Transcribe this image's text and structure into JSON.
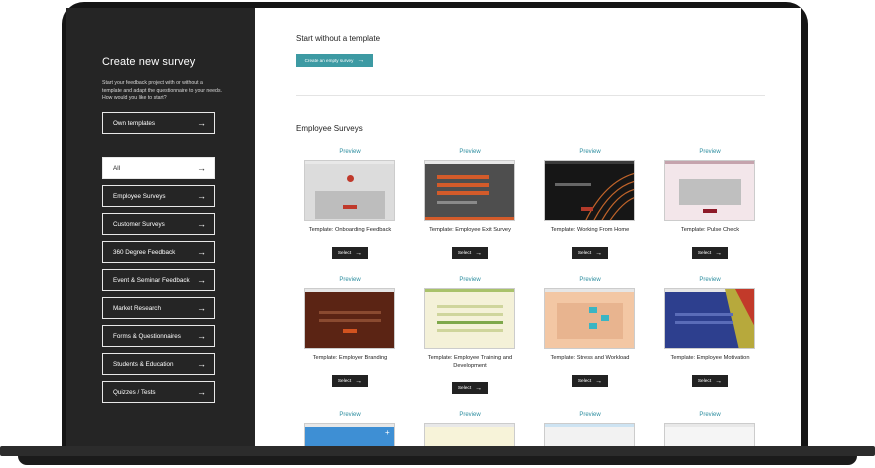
{
  "sidebar": {
    "title": "Create new survey",
    "description": "Start your feedback project with or without a template and adapt the questionnaire to your needs. How would you like to start?",
    "own_templates": "Own templates",
    "categories": [
      {
        "label": "All",
        "active": true
      },
      {
        "label": "Employee Surveys"
      },
      {
        "label": "Customer Surveys"
      },
      {
        "label": "360 Degree Feedback"
      },
      {
        "label": "Event & Seminar Feedback"
      },
      {
        "label": "Market Research"
      },
      {
        "label": "Forms & Questionnaires"
      },
      {
        "label": "Students & Education"
      },
      {
        "label": "Quizzes / Tests"
      }
    ],
    "arrow_icon": "arrow-right-icon"
  },
  "main": {
    "start_heading": "Start without a template",
    "create_empty_label": "Create an empty survey",
    "section_heading": "Employee Surveys",
    "preview_label": "Preview",
    "select_label": "Select",
    "templates": [
      {
        "title": "Template: Onboarding Feedback",
        "thumb_color": "#dcdcdc"
      },
      {
        "title": "Template: Employee Exit Survey",
        "thumb_color": "#4e4e4e"
      },
      {
        "title": "Template: Working From Home",
        "thumb_color": "#161616"
      },
      {
        "title": "Template: Pulse Check",
        "thumb_color": "#f3e6ea"
      },
      {
        "title": "Template: Employer Branding",
        "thumb_color": "#5b2414"
      },
      {
        "title": "Template: Employee Training and Development",
        "thumb_color": "#f4f1d8"
      },
      {
        "title": "Template: Stress and Workload",
        "thumb_color": "#f3c7a4"
      },
      {
        "title": "Template: Employee Motivation",
        "thumb_color": "#2d3f8e"
      },
      {
        "title": "",
        "thumb_color": "#3e8fd4"
      },
      {
        "title": "",
        "thumb_color": "#f7f3d9"
      },
      {
        "title": "",
        "thumb_color": "#f2f2f2"
      },
      {
        "title": "",
        "thumb_color": "#f5f5f5"
      }
    ]
  },
  "colors": {
    "accent": "#3d9aa3",
    "preview_link": "#2f8fa0",
    "sidebar_bg": "#252525"
  }
}
